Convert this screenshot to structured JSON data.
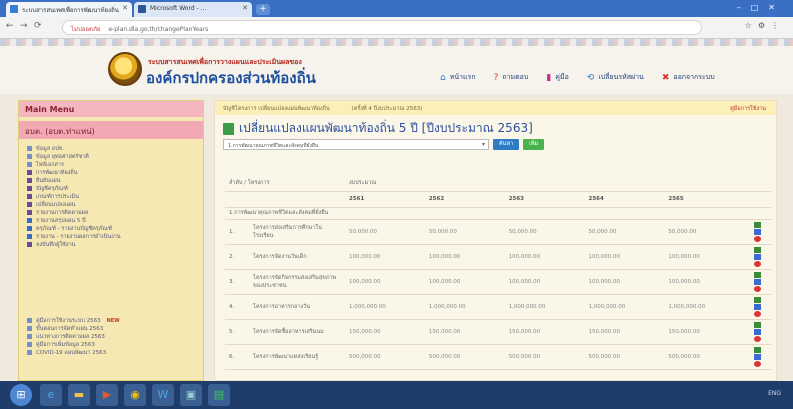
{
  "browser": {
    "tabs": [
      {
        "title": "ระบบสารสนเทศเพื่อการพัฒนาท้องถิ่น",
        "active": true
      },
      {
        "title": "Microsoft Word - ...",
        "active": false
      }
    ],
    "url_security": "ไม่ปลอดภัย",
    "url": "e-plan.dla.go.th/changePlanYears"
  },
  "site": {
    "title_small": "ระบบสารสนเทศเพื่อการวางแผนและประเมินผลของ",
    "title_big": "องค์กรปกครองส่วนท้องถิ่น",
    "nav": [
      {
        "label": "หน้าแรก",
        "icon": "home-icon"
      },
      {
        "label": "ถามตอบ",
        "icon": "question-icon"
      },
      {
        "label": "คู่มือ",
        "icon": "book-icon"
      },
      {
        "label": "เปลี่ยนรหัสผ่าน",
        "icon": "refresh-icon"
      },
      {
        "label": "ออกจากระบบ",
        "icon": "logout-icon"
      }
    ]
  },
  "sidebar": {
    "header": "Main Menu",
    "org": "อบต. (อบต.ท่าแหน่)",
    "menu": [
      "ข้อมูล อปท.",
      "ข้อมูล ยุทธศาสตร์ชาติ",
      "ไฟล์เอกสาร",
      "การพัฒนาท้องถิ่น",
      "ยืนยันแผน",
      "บัญชีครุภัณฑ์",
      "เกณฑ์การประเมิน",
      "เปลี่ยนแปลงแผน",
      "รายงานการติดตามผล",
      "รายงานสรุปแผน 5 ปี",
      "ครุภัณฑ์ - รายงานบัญชีครุภัณฑ์",
      "รายงาน - รายงานผลการดำเนินงาน",
      "ลงบันทึกผู้ใช้งาน"
    ],
    "downloads": [
      {
        "label": "คู่มือการใช้งานระบบ 2563",
        "new": "NEW"
      },
      {
        "label": "ขั้นตอนการจัดทำแผน 2563",
        "new": ""
      },
      {
        "label": "แนวทางการติดตามผล 2563",
        "new": ""
      },
      {
        "label": "คู่มือการเพิ่มข้อมูล 2563",
        "new": ""
      },
      {
        "label": "COVID-19 แผนพัฒนา 2563",
        "new": ""
      }
    ]
  },
  "content": {
    "breadcrumb": "บัญชีโครงการ เปลี่ยนแปลงแผนพัฒนาท้องถิ่น",
    "breadcrumb_note": "(ครั้งที่ 4 ปีงบประมาณ 2563)",
    "external_link": "คู่มือการใช้งาน",
    "title": "เปลี่ยนแปลงแผนพัฒนาท้องถิ่น 5 ปี [ปีงบประมาณ 2563]",
    "select_value": "1.การพัฒนาคุณภาพชีวิตและสังคมที่ยั่งยืน",
    "search_label": "ค้นหา",
    "add_label": "เพิ่ม",
    "table": {
      "col_project": "ลำดับ / โครงการ",
      "col_budget": "งบประมาณ",
      "years": [
        "2561",
        "2562",
        "2563",
        "2564",
        "2565"
      ],
      "section": "1.การพัฒนาคุณภาพชีวิตและสังคมที่ยั่งยืน",
      "rows": [
        {
          "no": "1.",
          "name": "โครงการส่งเสริมการศึกษาในโรงเรียน",
          "values": [
            "50,000.00",
            "50,000.00",
            "50,000.00",
            "50,000.00",
            "50,000.00"
          ]
        },
        {
          "no": "2.",
          "name": "โครงการจัดงานวันเด็ก",
          "values": [
            "100,000.00",
            "100,000.00",
            "100,000.00",
            "100,000.00",
            "100,000.00"
          ]
        },
        {
          "no": "3.",
          "name": "โครงการจัดกิจกรรมส่งเสริมสุขภาพของประชาชน",
          "values": [
            "100,000.00",
            "100,000.00",
            "100,000.00",
            "100,000.00",
            "100,000.00"
          ]
        },
        {
          "no": "4.",
          "name": "โครงการอาหารกลางวัน",
          "values": [
            "1,000,000.00",
            "1,000,000.00",
            "1,000,000.00",
            "1,000,000.00",
            "1,000,000.00"
          ]
        },
        {
          "no": "5.",
          "name": "โครงการจัดซื้ออาหารเสริมนม",
          "values": [
            "150,000.00",
            "150,000.00",
            "150,000.00",
            "150,000.00",
            "150,000.00"
          ]
        },
        {
          "no": "6.",
          "name": "โครงการพัฒนาแหล่งเรียนรู้",
          "values": [
            "500,000.00",
            "500,000.00",
            "500,000.00",
            "500,000.00",
            "500,000.00"
          ]
        }
      ]
    }
  },
  "taskbar": {
    "apps": [
      "start-icon",
      "ie-icon",
      "folder-icon",
      "media-icon",
      "chrome-icon",
      "word-icon",
      "app-icon",
      "line-icon"
    ],
    "clock": "ENG"
  }
}
